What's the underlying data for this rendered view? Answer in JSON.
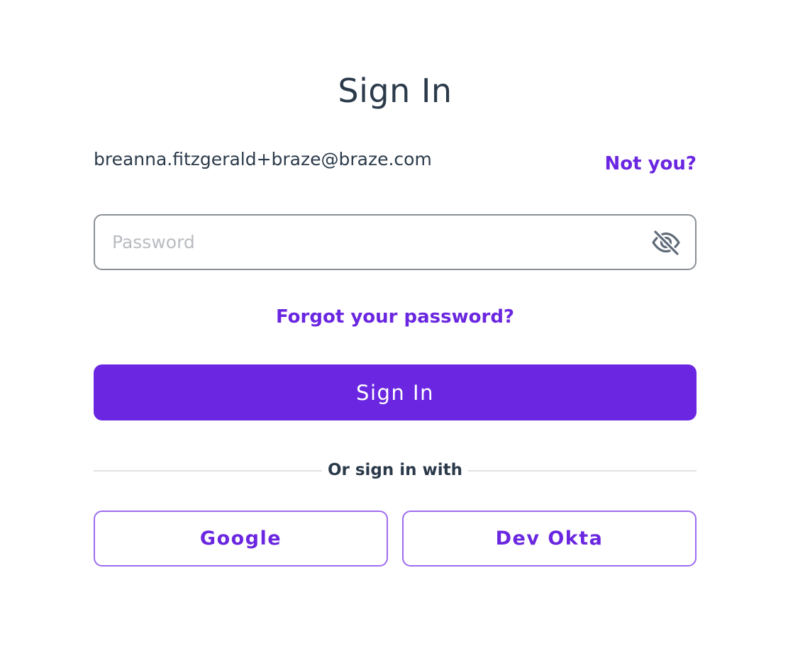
{
  "page": {
    "title": "Sign In"
  },
  "account": {
    "email": "breanna.fitzgerald+braze@braze.com",
    "not_you_label": "Not you?"
  },
  "password": {
    "placeholder": "Password",
    "value": "",
    "visibility_icon": "eye-slash-icon"
  },
  "forgot_label": "Forgot your password?",
  "submit_label": "Sign In",
  "sso": {
    "divider_label": "Or sign in with",
    "providers": [
      {
        "label": "Google"
      },
      {
        "label": "Dev Okta"
      }
    ]
  },
  "colors": {
    "accent": "#6a26e0",
    "accent_border": "#9d6cf0",
    "text": "#2b3a4a",
    "placeholder": "#b9bcc1",
    "input_border": "#8a8f96",
    "divider": "#dfe1e5"
  }
}
